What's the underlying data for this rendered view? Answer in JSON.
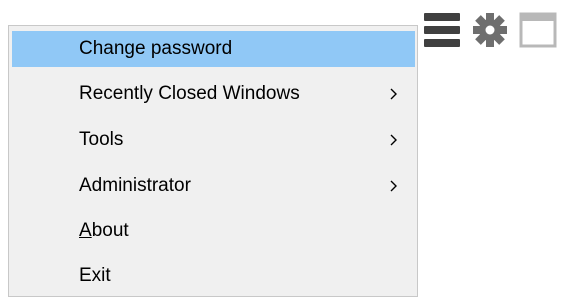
{
  "toolbar": {
    "icons": [
      "hamburger-icon",
      "gear-icon",
      "window-icon"
    ],
    "colors": {
      "hamburger": "#404040",
      "gear": "#6e6e6e",
      "window": "#b8b8b8"
    }
  },
  "menu": {
    "items": [
      {
        "label": "Change password",
        "highlighted": true,
        "submenu": false
      },
      {
        "label": "Recently Closed Windows",
        "highlighted": false,
        "submenu": true
      },
      {
        "label": "Tools",
        "highlighted": false,
        "submenu": true
      },
      {
        "label": "Administrator",
        "highlighted": false,
        "submenu": true
      },
      {
        "label_first": "A",
        "label_rest": "bout",
        "highlighted": false,
        "submenu": false
      },
      {
        "label": "Exit",
        "highlighted": false,
        "submenu": false
      }
    ],
    "colors": {
      "background": "#f0f0f0",
      "highlight": "#90c8f6",
      "border": "#c8c8c8"
    }
  }
}
